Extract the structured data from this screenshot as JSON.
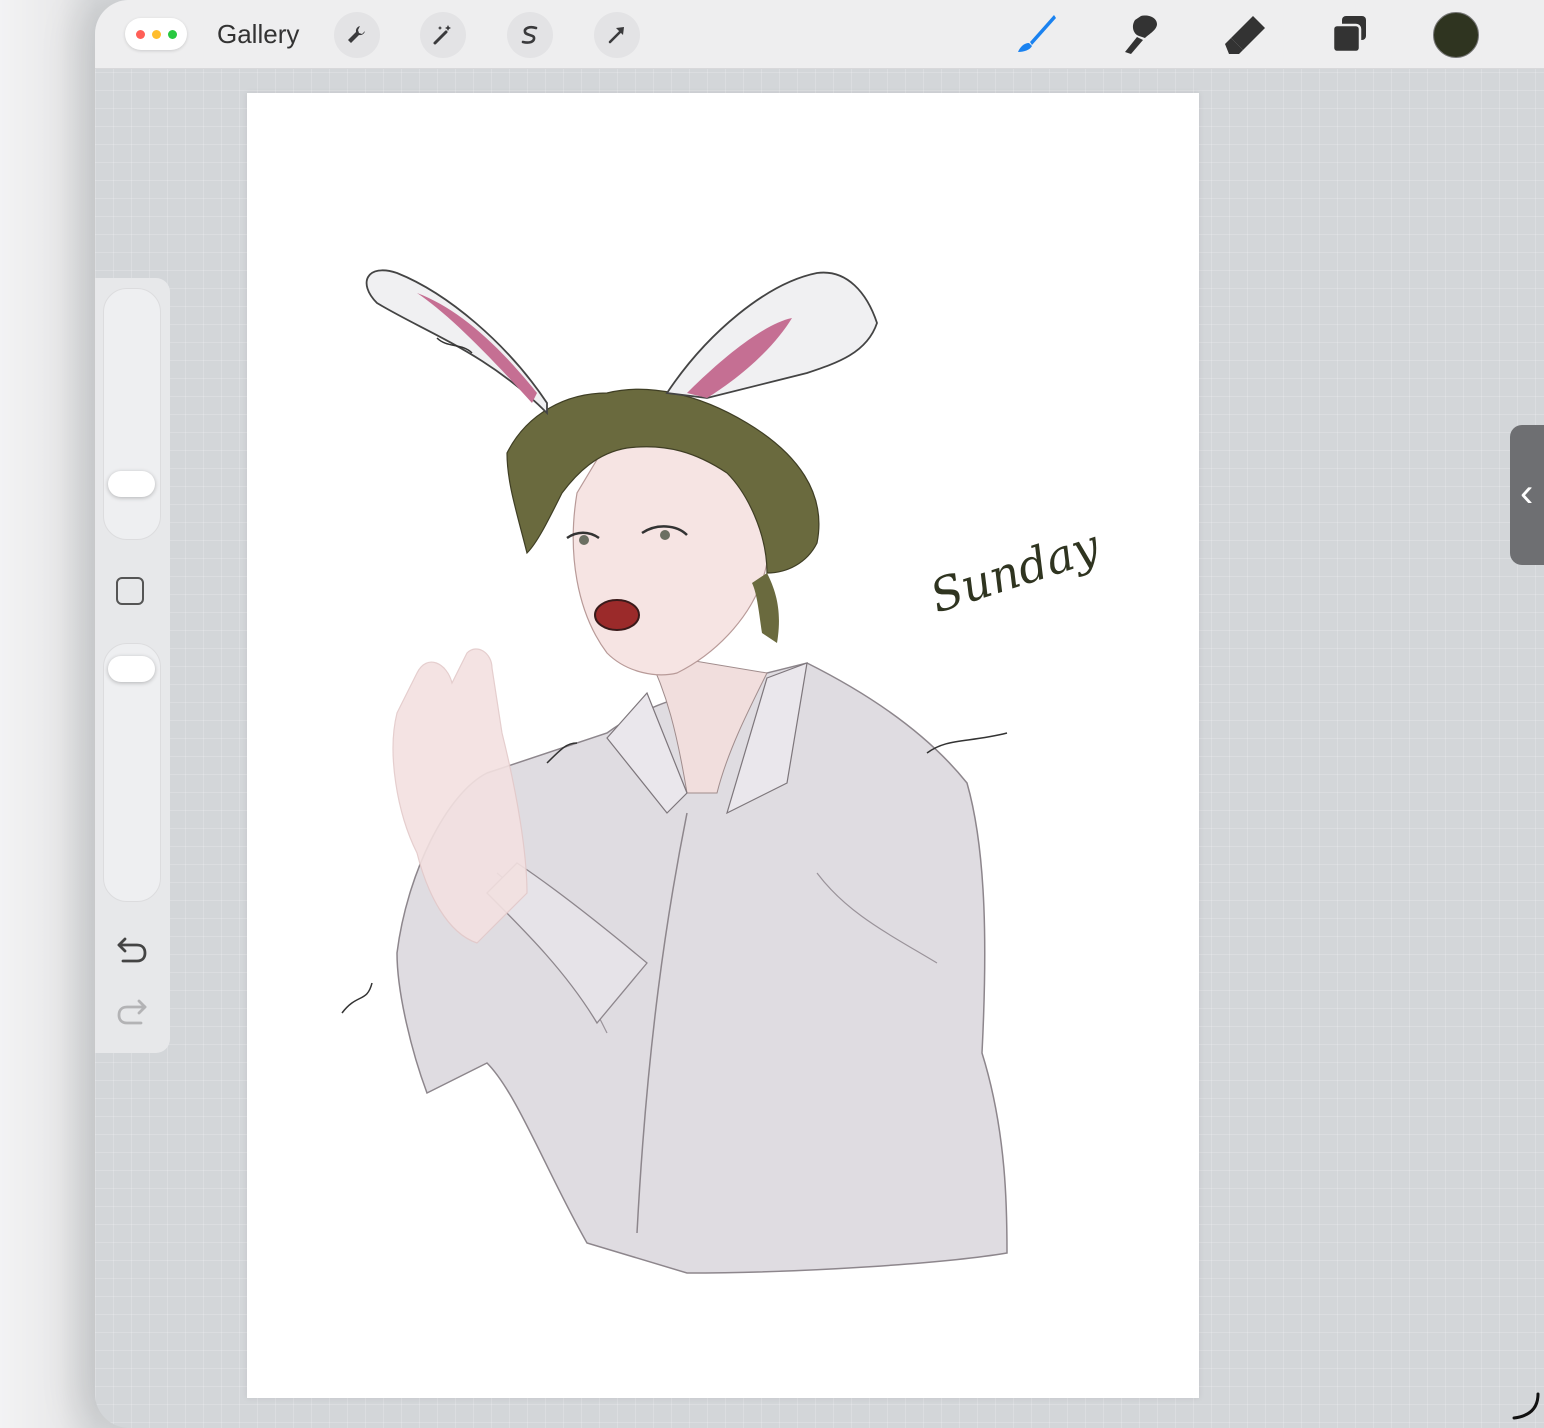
{
  "app": {
    "gallery_label": "Gallery"
  },
  "toolbar": {
    "left_tools": [
      "wrench-icon",
      "magic-wand-icon",
      "selection-s-icon",
      "transform-arrow-icon"
    ],
    "right_tools": [
      "brush-icon",
      "smudge-icon",
      "eraser-icon",
      "layers-icon"
    ],
    "active_tool": "brush-icon",
    "current_color": "#2f3420",
    "accent_color": "#1a82f0"
  },
  "sidebar": {
    "brush_size": 0.72,
    "brush_opacity": 0.0,
    "undo_icon": "undo-arrow-icon",
    "redo_icon": "redo-arrow-icon"
  },
  "artwork": {
    "signature": "Sunday",
    "subject": "drawing"
  },
  "right_tab": {
    "glyph": "‹"
  }
}
